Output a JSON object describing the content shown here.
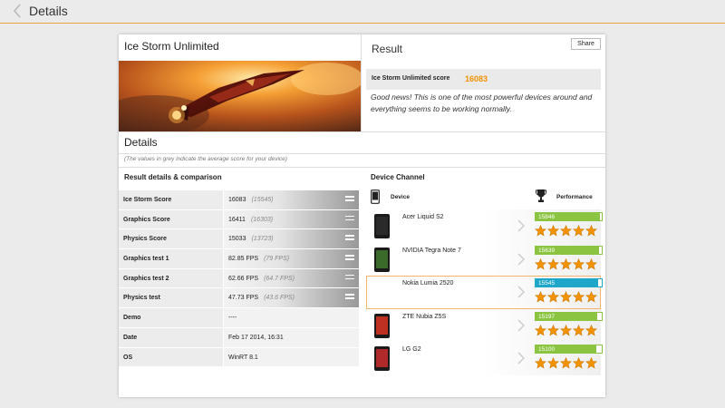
{
  "header": {
    "title": "Details"
  },
  "benchmark": {
    "name": "Ice Storm Unlimited"
  },
  "result": {
    "title": "Result",
    "share_label": "Share",
    "score_label": "Ice Storm Unlimited score",
    "score_value": "16083",
    "message": "Good news! This is one of the most powerful devices around and everything seems to be working normally."
  },
  "details": {
    "title": "Details",
    "note": "(The values in grey indicate the average score for your device)",
    "section_title": "Result details & comparison",
    "rows": [
      {
        "label": "Ice Storm Score",
        "value": "16083",
        "avg": "(15545)"
      },
      {
        "label": "Graphics Score",
        "value": "16411",
        "avg": "(16303)"
      },
      {
        "label": "Physics Score",
        "value": "15033",
        "avg": "(13723)"
      },
      {
        "label": "Graphics test 1",
        "value": "82.85 FPS",
        "avg": "(79 FPS)"
      },
      {
        "label": "Graphics test 2",
        "value": "62.66 FPS",
        "avg": "(64.7 FPS)"
      },
      {
        "label": "Physics test",
        "value": "47.73 FPS",
        "avg": "(43.6 FPS)"
      },
      {
        "label": "Demo",
        "value": "----",
        "avg": ""
      },
      {
        "label": "Date",
        "value": "Feb 17 2014, 16:31",
        "avg": ""
      },
      {
        "label": "OS",
        "value": "WinRT 8.1",
        "avg": ""
      }
    ]
  },
  "device_channel": {
    "title": "Device Channel",
    "device_col": "Device",
    "performance_col": "Performance",
    "devices": [
      {
        "name": "Acer Liquid S2",
        "score": "15846",
        "fill": 0.97,
        "stars": 5,
        "selected": false,
        "screen": "#2a2a2a"
      },
      {
        "name": "NVIDIA Tegra Note 7",
        "score": "15639",
        "fill": 0.96,
        "stars": 5,
        "selected": false,
        "screen": "#3a6b2a"
      },
      {
        "name": "Nokia Lumia 2520",
        "score": "15545",
        "fill": 0.95,
        "stars": 5,
        "selected": true,
        "screen": ""
      },
      {
        "name": "ZTE Nubia Z5S",
        "score": "15197",
        "fill": 0.93,
        "stars": 5,
        "selected": false,
        "screen": "#c03020"
      },
      {
        "name": "LG G2",
        "score": "15100",
        "fill": 0.92,
        "stars": 5,
        "selected": false,
        "screen": "#b02a2a"
      }
    ]
  },
  "colors": {
    "accent": "#f39200",
    "bar_green": "#8ac440",
    "bar_selected": "#1fa7c9",
    "star": "#f39200"
  }
}
